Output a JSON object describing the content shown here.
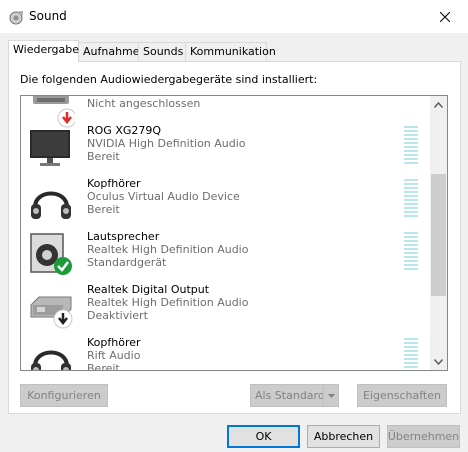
{
  "window": {
    "title": "Sound",
    "close_icon": "close-icon",
    "app_icon": "speaker-settings-icon"
  },
  "tabs": [
    {
      "label": "Wiedergabe",
      "active": true
    },
    {
      "label": "Aufnahme",
      "active": false
    },
    {
      "label": "Sounds",
      "active": false
    },
    {
      "label": "Kommunikation",
      "active": false
    }
  ],
  "panel": {
    "label": "Die folgenden Audiowiedergabegeräte sind installiert:"
  },
  "devices": [
    {
      "name": "",
      "desc": "Nicht angeschlossen",
      "state": "",
      "icon": "speaker-disconnected-icon",
      "badge": "down-arrow-red"
    },
    {
      "name": "ROG XG279Q",
      "desc": "NVIDIA High Definition Audio",
      "state": "Bereit",
      "icon": "monitor-icon"
    },
    {
      "name": "Kopfhörer",
      "desc": "Oculus Virtual Audio Device",
      "state": "Bereit",
      "icon": "headphones-icon"
    },
    {
      "name": "Lautsprecher",
      "desc": "Realtek High Definition Audio",
      "state": "Standardgerät",
      "icon": "speaker-icon",
      "badge": "check-green"
    },
    {
      "name": "Realtek Digital Output",
      "desc": "Realtek High Definition Audio",
      "state": "Deaktiviert",
      "icon": "digital-output-icon",
      "badge": "down-arrow-black"
    },
    {
      "name": "Kopfhörer",
      "desc": "Rift Audio",
      "state": "Bereit",
      "icon": "headphones-icon"
    }
  ],
  "buttons": {
    "configure": "Konfigurieren",
    "set_default": "Als Standard",
    "properties": "Eigenschaften",
    "ok": "OK",
    "cancel": "Abbrechen",
    "apply": "Übernehmen"
  }
}
